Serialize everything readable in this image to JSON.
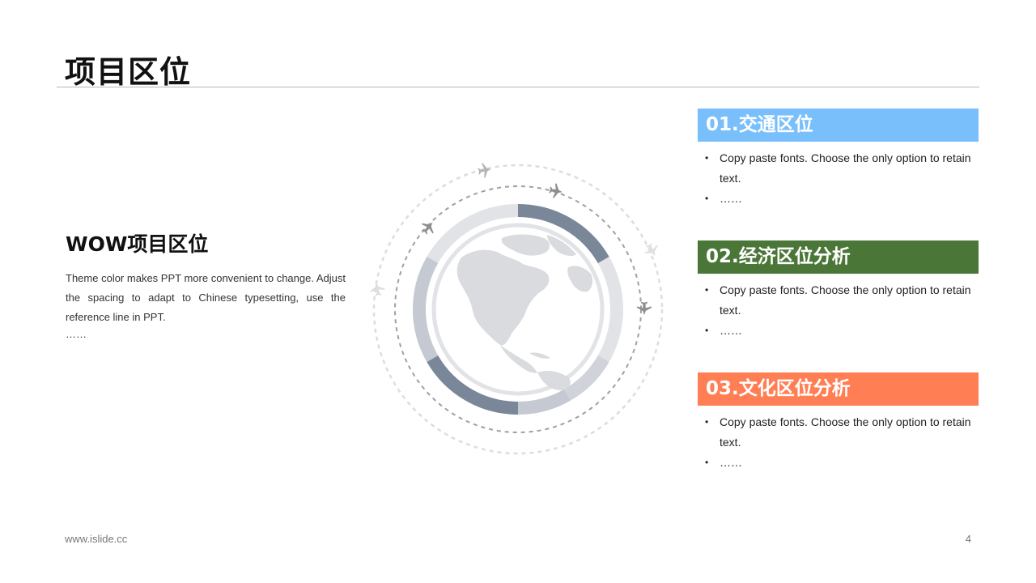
{
  "slide": {
    "title": "项目区位"
  },
  "left": {
    "heading": "WOW项目区位",
    "body": "Theme color makes PPT more convenient to change. Adjust the spacing to adapt to Chinese typesetting, use the reference line in PPT.",
    "ellipsis": "……"
  },
  "sections": [
    {
      "header": "01.交通区位",
      "color": "#79BFFB",
      "bullets": [
        "Copy paste fonts. Choose the only option to retain text.",
        "……"
      ]
    },
    {
      "header": "02.经济区位分析",
      "color": "#4A7637",
      "bullets": [
        "Copy paste fonts. Choose the only option to retain text.",
        "……"
      ]
    },
    {
      "header": "03.文化区位分析",
      "color": "#FF7E54",
      "bullets": [
        "Copy paste fonts. Choose the only option to retain text.",
        "……"
      ]
    }
  ],
  "graphic": {
    "icons": [
      "globe-icon",
      "airplane-icon"
    ],
    "colors": {
      "ring_dark": "#7A8799",
      "ring_mid": "#C5CAD2",
      "ring_light": "#E1E3E7",
      "globe_fill": "#D9DBDE",
      "dash": "#9E9E9E",
      "dash_light": "#DDDDDD"
    }
  },
  "footer": {
    "url": "www.islide.cc",
    "page": "4"
  }
}
